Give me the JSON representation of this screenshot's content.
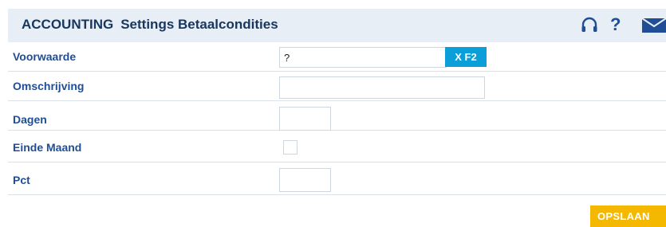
{
  "header": {
    "app": "ACCOUNTING",
    "title": "Settings Betaalcondities",
    "icons": [
      "headset-icon",
      "help-icon",
      "mail-icon"
    ],
    "help_glyph": "?"
  },
  "form": {
    "voorwaarde": {
      "label": "Voorwaarde",
      "value": "?",
      "button": "X F2"
    },
    "omschrijving": {
      "label": "Omschrijving",
      "value": ""
    },
    "dagen": {
      "label": "Dagen",
      "value": ""
    },
    "einde_maand": {
      "label": "Einde Maand",
      "checked": false
    },
    "pct": {
      "label": "Pct",
      "value": ""
    }
  },
  "actions": {
    "save_label": "OPSLAAN"
  },
  "colors": {
    "header_bg": "#e8eef6",
    "title": "#17375e",
    "label": "#1f4e96",
    "button_blue": "#0a9fd8",
    "save_yellow": "#f5b800"
  }
}
